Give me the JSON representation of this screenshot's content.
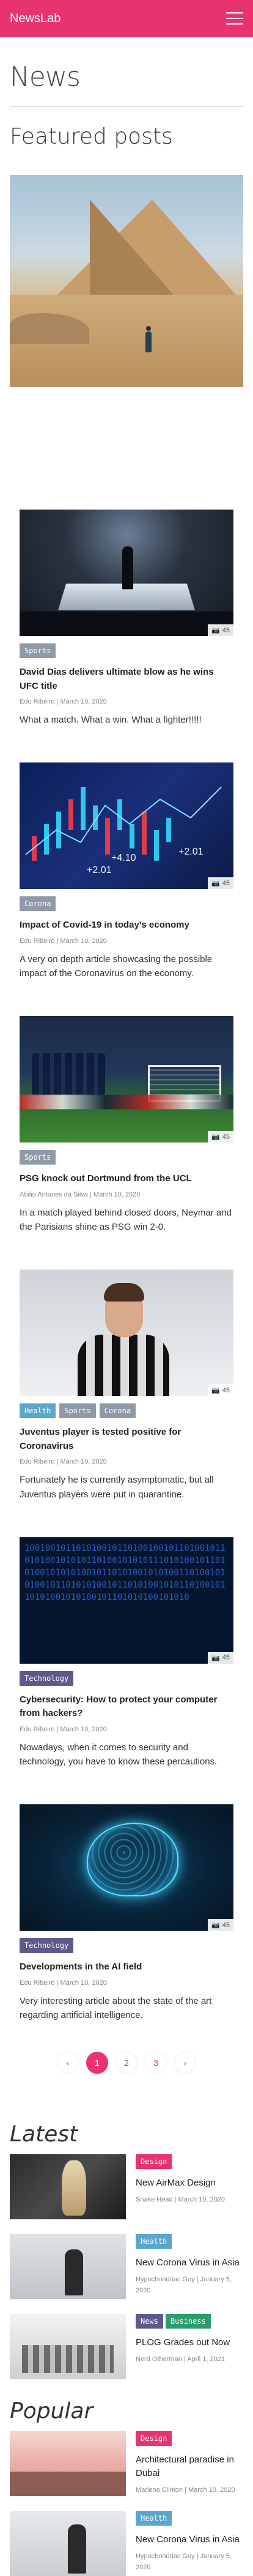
{
  "header": {
    "brand": "NewsLab",
    "menu_icon": "hamburger-menu-icon",
    "color": "#e8336e"
  },
  "page": {
    "title": "News",
    "featured_title": "Featured posts"
  },
  "posts": [
    {
      "image": "ufc",
      "count": "45",
      "tags": [
        {
          "label": "Sports",
          "color": "#8f9aa8"
        }
      ],
      "title": "David Dias delivers ultimate blow as he wins UFC title",
      "author": "Edu Ribeiro",
      "date": "March 10, 2020",
      "excerpt": "What a match. What a win. What a fighter!!!!!"
    },
    {
      "image": "covid",
      "count": "45",
      "tags": [
        {
          "label": "Corona",
          "color": "#8f9aa8"
        }
      ],
      "title": "Impact of Covid-19 in today's economy",
      "author": "Edu Ribeiro",
      "date": "March 10, 2020",
      "excerpt": "A very on depth article showcasing the possible impact of the Coronavirus on the economy."
    },
    {
      "image": "psg",
      "count": "45",
      "tags": [
        {
          "label": "Sports",
          "color": "#8f9aa8"
        }
      ],
      "title": "PSG knock out Dortmund from the UCL",
      "author": "Abilio Antunes da Silva",
      "date": "March 10, 2020",
      "excerpt": "In a match played behind closed doors, Neymar and the Parisians shine as PSG win 2-0."
    },
    {
      "image": "juve",
      "count": "45",
      "tags": [
        {
          "label": "Health",
          "color": "#5aa6cc"
        },
        {
          "label": "Sports",
          "color": "#8f9aa8"
        },
        {
          "label": "Corona",
          "color": "#8f9aa8"
        }
      ],
      "title": "Juventus player is tested positive for Coronavirus",
      "author": "Edu Ribeiro",
      "date": "March 10, 2020",
      "excerpt": "Fortunately he is currently asymptomatic, but all Juventus players were put in quarantine."
    },
    {
      "image": "cyber",
      "count": "45",
      "tags": [
        {
          "label": "Technology",
          "color": "#5b5a8a"
        }
      ],
      "title": "Cybersecurity: How to protect your computer from hackers?",
      "author": "Edu Ribeiro",
      "date": "March 10, 2020",
      "excerpt": "Nowadays, when it comes to security and technology, you have to know these percautions."
    },
    {
      "image": "ai",
      "count": "45",
      "tags": [
        {
          "label": "Technology",
          "color": "#5b5a8a"
        }
      ],
      "title": "Developments in the AI field",
      "author": "Edu Ribeiro",
      "date": "March 10, 2020",
      "excerpt": "Very interesting article about the state of the art regarding artificial intelligence."
    }
  ],
  "cyber_bits": "10010010110101001011010010010110100101101010010101011010010101011101010010110101001010101001011010100101010011010010101001011010101001011010100101011010010110101001010100101101010100101010",
  "covid_numbers": [
    "+4.10",
    "+2.01",
    "+2.01"
  ],
  "pagination": {
    "prev": "‹",
    "next": "›",
    "pages": [
      "1",
      "2",
      "3"
    ],
    "active": "1"
  },
  "latest": {
    "title": "Latest",
    "items": [
      {
        "thumb": "airmax",
        "tags": [
          {
            "label": "Design",
            "color": "#e8336e"
          }
        ],
        "title": "New AirMax Design",
        "meta": "Snake Head | March 10, 2020"
      },
      {
        "thumb": "corona",
        "tags": [
          {
            "label": "Health",
            "color": "#5aa6cc"
          }
        ],
        "title": "New Corona Virus in Asia",
        "meta": "Hypochondriac Guy | January 5, 2020"
      },
      {
        "thumb": "plog",
        "tags": [
          {
            "label": "News",
            "color": "#5b5a8a"
          },
          {
            "label": "Business",
            "color": "#2a9d6e"
          }
        ],
        "title": "PLOG Grades out Now",
        "meta": "Nerd Otherman | April 1, 2021"
      }
    ]
  },
  "popular": {
    "title": "Popular",
    "items": [
      {
        "thumb": "arch",
        "tags": [
          {
            "label": "Design",
            "color": "#e8336e"
          }
        ],
        "title": "Architectural paradise in Dubai",
        "meta": "Marlena Clinton | March 10, 2020"
      },
      {
        "thumb": "corona2",
        "tags": [
          {
            "label": "Health",
            "color": "#5aa6cc"
          }
        ],
        "title": "New Corona Virus in Asia",
        "meta": "Hypochondriac Guy | January 5, 2020"
      }
    ]
  }
}
